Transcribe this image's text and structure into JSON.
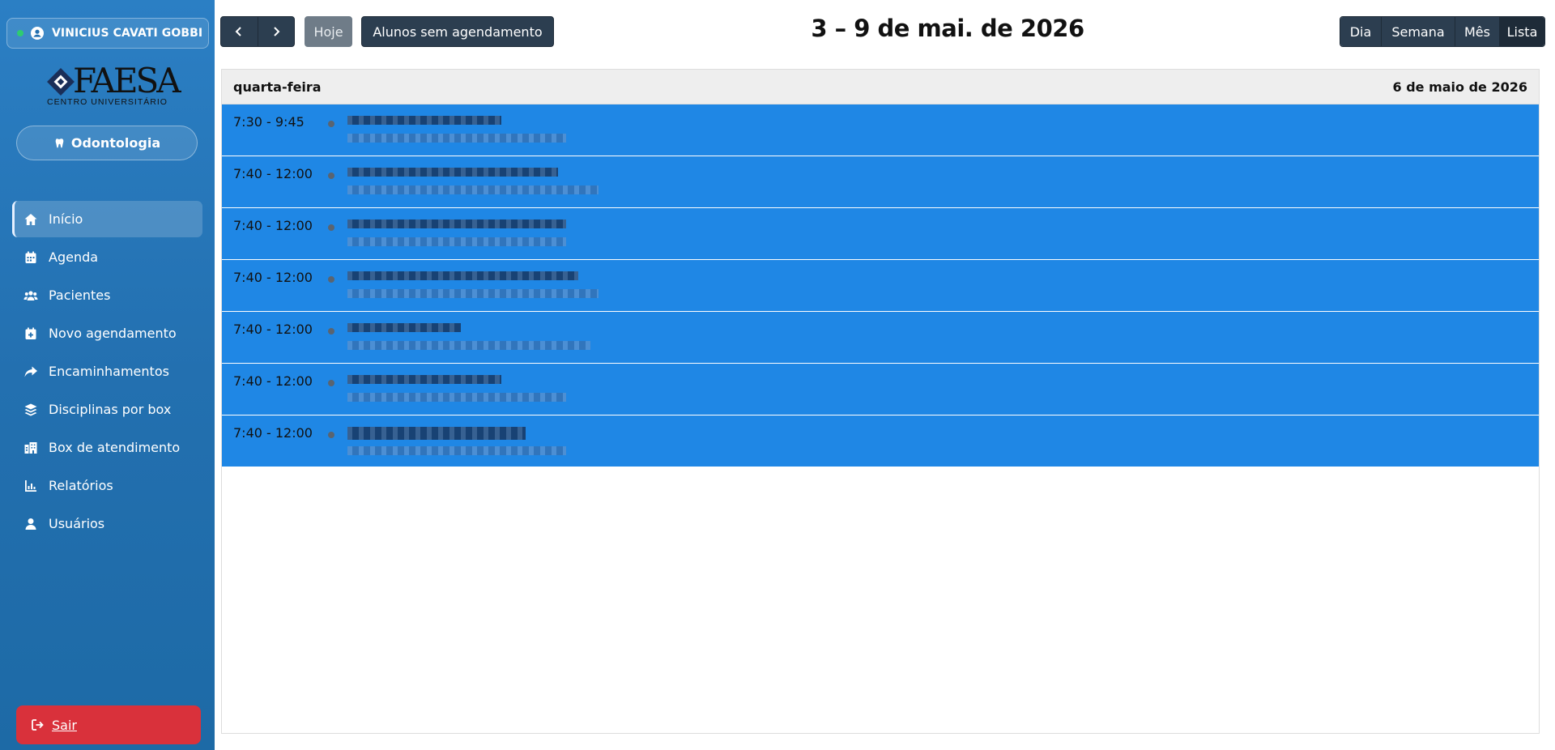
{
  "user": {
    "name": "VINICIUS CAVATI GOBBI"
  },
  "logo": {
    "text": "FAESA",
    "subtitle": "CENTRO UNIVERSITÁRIO"
  },
  "course": {
    "label": "Odontologia"
  },
  "nav": [
    {
      "label": "Início",
      "icon": "home-icon",
      "active": true
    },
    {
      "label": "Agenda",
      "icon": "calendar-icon"
    },
    {
      "label": "Pacientes",
      "icon": "users-icon"
    },
    {
      "label": "Novo agendamento",
      "icon": "calendar-plus-icon"
    },
    {
      "label": "Encaminhamentos",
      "icon": "share-icon"
    },
    {
      "label": "Disciplinas por box",
      "icon": "layers-icon"
    },
    {
      "label": "Box de atendimento",
      "icon": "building-icon"
    },
    {
      "label": "Relatórios",
      "icon": "chart-icon"
    },
    {
      "label": "Usuários",
      "icon": "user-icon"
    }
  ],
  "logout": {
    "label": "Sair"
  },
  "toolbar": {
    "today": "Hoje",
    "no_appointment": "Alunos sem agendamento",
    "range_title": "3 – 9 de mai. de 2026",
    "views": [
      {
        "label": "Dia"
      },
      {
        "label": "Semana"
      },
      {
        "label": "Mês"
      },
      {
        "label": "Lista",
        "active": true
      }
    ]
  },
  "list": {
    "day_name": "quarta-feira",
    "day_date": "6 de maio de 2026",
    "events": [
      {
        "time": "7:30 - 9:45"
      },
      {
        "time": "7:40 - 12:00"
      },
      {
        "time": "7:40 - 12:00"
      },
      {
        "time": "7:40 - 12:00"
      },
      {
        "time": "7:40 - 12:00"
      },
      {
        "time": "7:40 - 12:00"
      },
      {
        "time": "7:40 - 12:00"
      }
    ]
  },
  "colors": {
    "sidebar": "#2370b0",
    "event": "#1f87e5",
    "toolbar": "#2c3e50",
    "logout": "#d9313b"
  }
}
